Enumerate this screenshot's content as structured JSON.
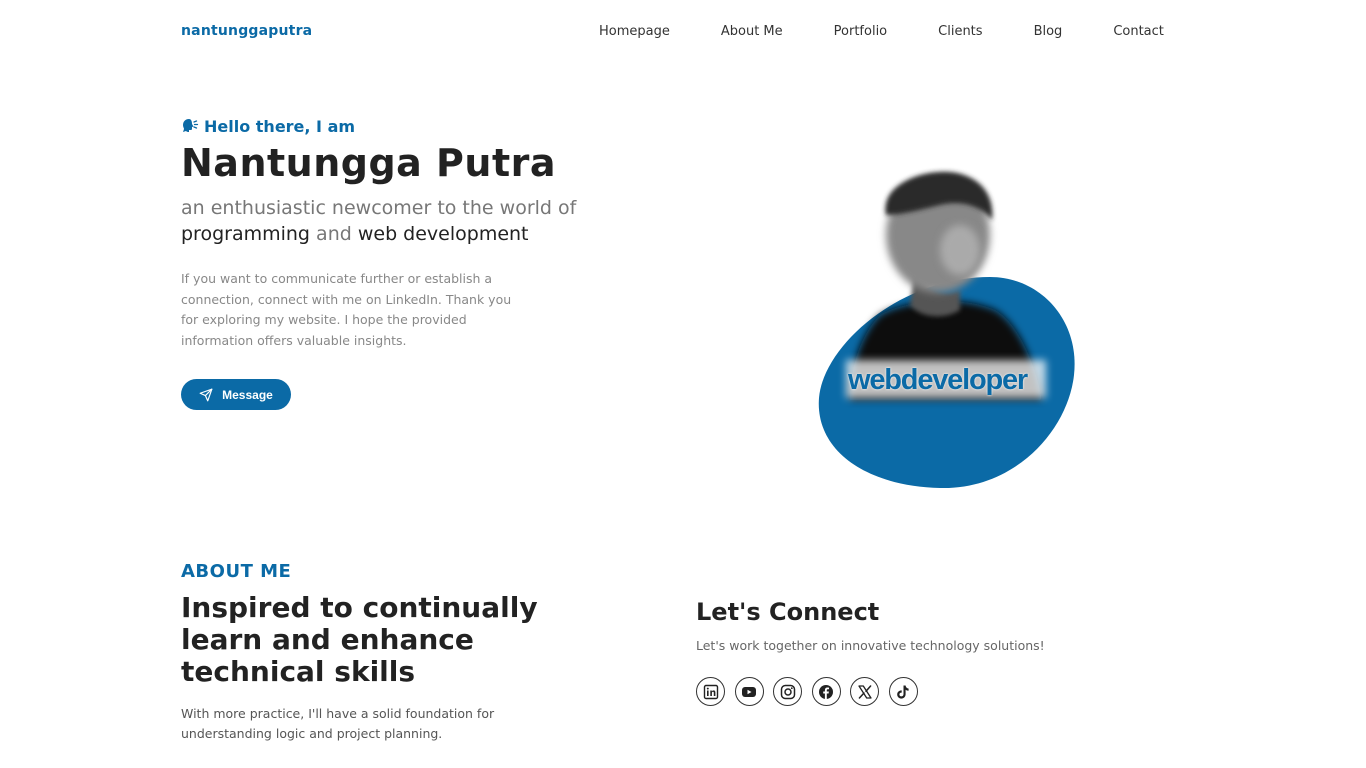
{
  "nav": {
    "brand": "nantunggaputra",
    "links": [
      "Homepage",
      "About Me",
      "Portfolio",
      "Clients",
      "Blog",
      "Contact"
    ]
  },
  "hero": {
    "greeting": "Hello there, I am",
    "greeting_icon": "speaking-head-icon",
    "name": "Nantungga Putra",
    "tagline_start": "an enthusiastic newcomer to the world of",
    "tagline_highlight1": "programming",
    "tagline_and": "and",
    "tagline_highlight2": "web development",
    "description": "If you want to communicate further or establish a connection, connect with me on LinkedIn. Thank you for exploring my website. I hope the provided information offers valuable insights.",
    "message_button": "Message",
    "portrait_text": "webdeveloper"
  },
  "about": {
    "label": "ABOUT ME",
    "title": "Inspired to continually learn and enhance technical skills",
    "text": "With more practice, I'll have a solid foundation for understanding logic and project planning."
  },
  "connect": {
    "title": "Let's Connect",
    "text": "Let's work together on innovative technology solutions!",
    "socials": [
      "linkedin-icon",
      "youtube-icon",
      "instagram-icon",
      "facebook-icon",
      "x-icon",
      "tiktok-icon"
    ]
  },
  "colors": {
    "accent": "#0b6aa6",
    "text": "#222222",
    "muted": "#888888"
  }
}
